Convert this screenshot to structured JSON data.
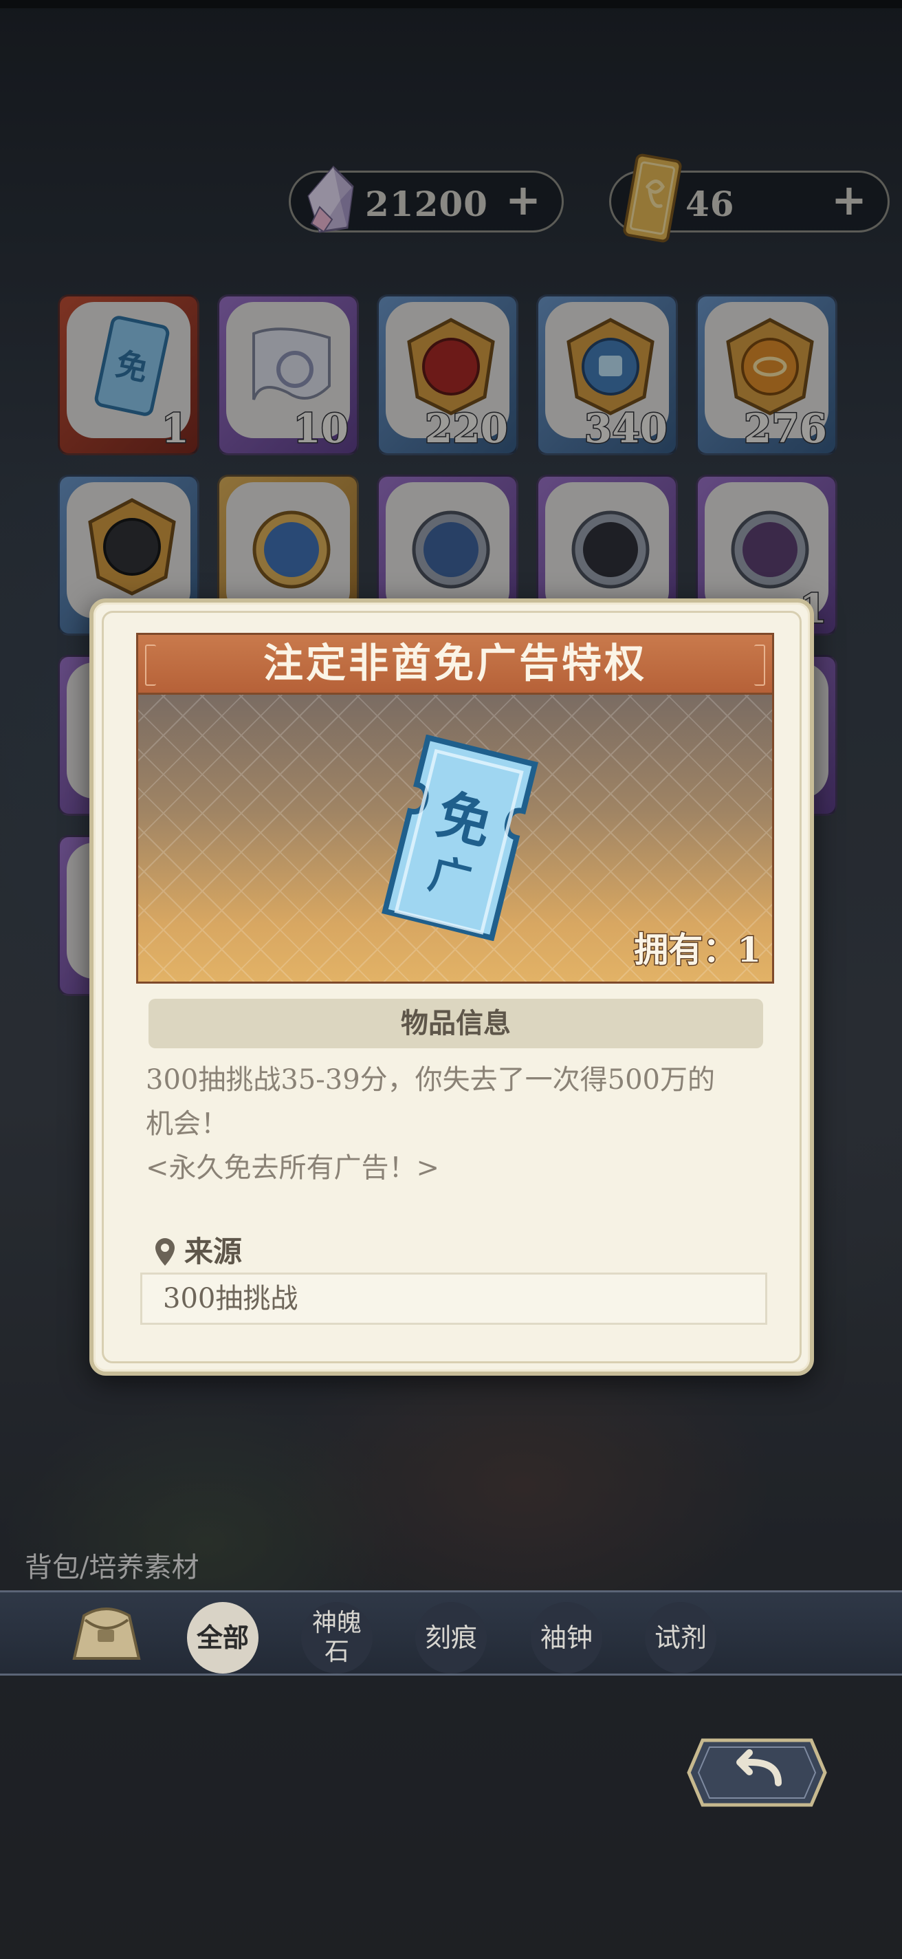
{
  "currency": {
    "gems": {
      "icon": "crystal-gem-icon",
      "amount": "21200",
      "plus": "+"
    },
    "tickets": {
      "icon": "summon-ticket-icon",
      "amount": "46",
      "plus": "+"
    }
  },
  "inventory": [
    {
      "icon": "ad-free-ticket-icon",
      "count": "1",
      "rarity": "red"
    },
    {
      "icon": "scroll-icon",
      "count": "10",
      "rarity": "purple"
    },
    {
      "icon": "beast-emblem-icon",
      "count": "220",
      "rarity": "blue"
    },
    {
      "icon": "shield-emblem-icon",
      "count": "340",
      "rarity": "blue"
    },
    {
      "icon": "eye-emblem-icon",
      "count": "276",
      "rarity": "blue"
    },
    {
      "icon": "dark-emblem-icon",
      "count": "",
      "rarity": "blue"
    },
    {
      "icon": "character-medal-icon",
      "count": "",
      "rarity": "gold"
    },
    {
      "icon": "character-medal-icon",
      "count": "",
      "rarity": "purple"
    },
    {
      "icon": "character-medal-icon",
      "count": "",
      "rarity": "purple"
    },
    {
      "icon": "character-medal-icon",
      "count": "1",
      "rarity": "purple"
    }
  ],
  "modal": {
    "title": "注定非酋免广告特权",
    "owned_text": "拥有：1",
    "section_title": "物品信息",
    "description_lines": [
      "300抽挑战35-39分，你失去了一次得500万的",
      "机会！",
      "<永久免去所有广告！>"
    ],
    "source_label": "来源",
    "source_value": "300抽挑战"
  },
  "breadcrumb": "背包/培养素材",
  "tabs": [
    {
      "label": "全部",
      "active": true
    },
    {
      "label": "神魄石",
      "active": false
    },
    {
      "label": "刻痕",
      "active": false
    },
    {
      "label": "袖钟",
      "active": false
    },
    {
      "label": "试剂",
      "active": false
    }
  ],
  "colors": {
    "modal_title_bg": "#b66138",
    "modal_bg": "#f6f2e4",
    "tab_active_bg": "#d9d3c6"
  }
}
